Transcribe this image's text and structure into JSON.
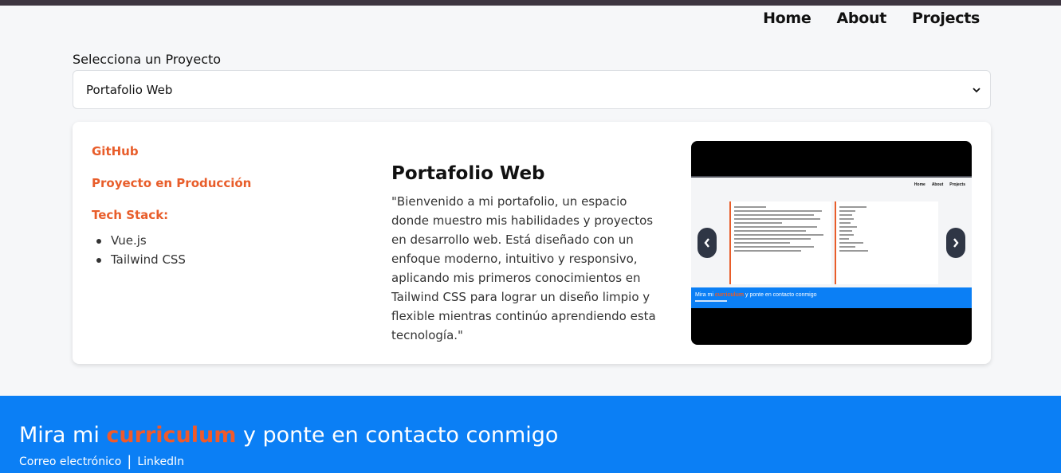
{
  "nav": {
    "items": [
      {
        "label": "Home"
      },
      {
        "label": "About"
      },
      {
        "label": "Projects"
      }
    ]
  },
  "selector": {
    "label": "Selecciona un Proyecto",
    "selected": "Portafolio Web"
  },
  "project": {
    "github_label": "GitHub",
    "production_label": "Proyecto en Producción",
    "tech_stack_label": "Tech Stack:",
    "tech_stack": [
      "Vue.js",
      "Tailwind CSS"
    ],
    "title": "Portafolio Web",
    "description": "\"Bienvenido a mi portafolio, un espacio donde muestro mis habilidades y proyectos en desarrollo web. Está diseñado con un enfoque moderno, intuitivo y responsivo, aplicando mis primeros conocimientos en Tailwind CSS para lograr un diseño limpio y flexible mientras continúo aprendiendo esta tecnología.\""
  },
  "carousel": {
    "preview_nav": [
      "Home",
      "About",
      "Projects"
    ],
    "preview_footer_prefix": "Mira mi ",
    "preview_footer_highlight": "curriculum",
    "preview_footer_suffix": " y ponte en contacto conmigo",
    "prev_icon": "chevron-left-icon",
    "next_icon": "chevron-right-icon"
  },
  "footer": {
    "cta_prefix": "Mira mi ",
    "cta_highlight": "curriculum",
    "cta_suffix": " y ponte en contacto conmigo",
    "email_label": "Correo electrónico",
    "separator": "|",
    "linkedin_label": "LinkedIn"
  },
  "colors": {
    "accent": "#e85d2a",
    "footer_bg": "#0b7ff5",
    "topbar": "#3d3540",
    "carousel_button": "#2f3645"
  }
}
